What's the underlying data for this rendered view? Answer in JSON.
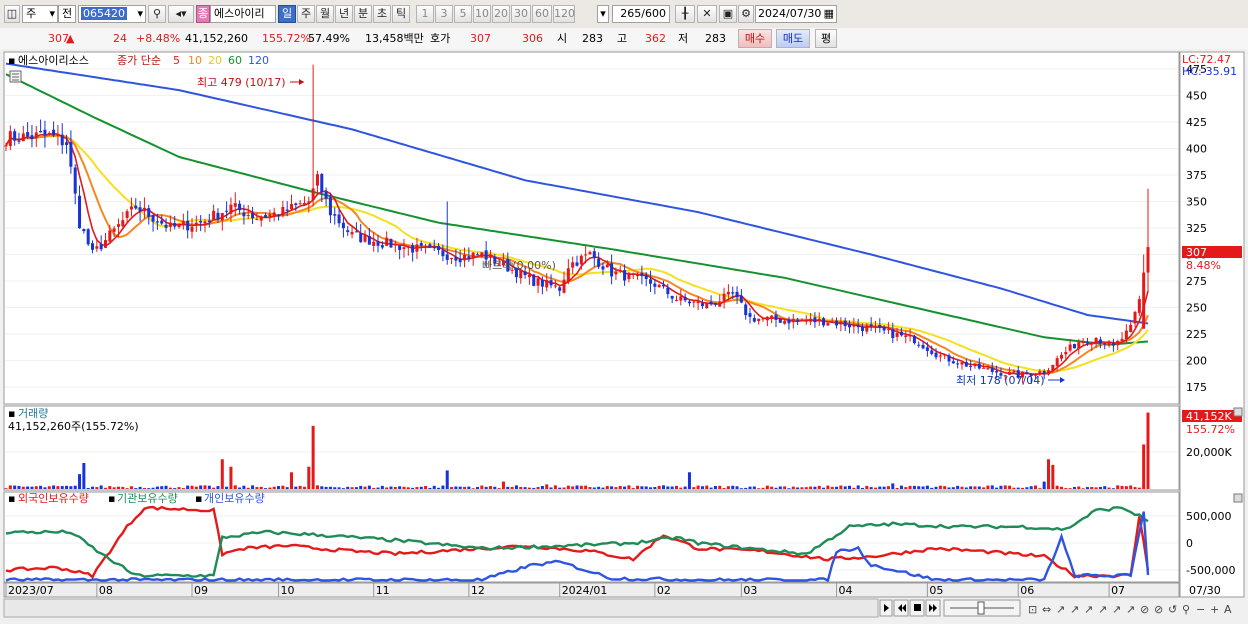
{
  "toolbar": {
    "period_type": "주",
    "prev_label": "전",
    "code": "065420",
    "name": "에스아이리",
    "name_badge": "종",
    "periods": [
      "일",
      "주",
      "월",
      "년",
      "분",
      "초",
      "틱"
    ],
    "active_period": "일",
    "intervals": [
      "1",
      "3",
      "5",
      "10",
      "20",
      "30",
      "60",
      "120"
    ],
    "count": "265",
    "count_total": "/600",
    "date": "2024/07/30"
  },
  "quote": {
    "price": "307",
    "change_arrow": "▲",
    "change": "24",
    "change_pct": "+8.48%",
    "volume": "41,152,260",
    "volume_pct": "155.72%",
    "turnover": "57.49%",
    "amount": "13,458백만",
    "bid_label": "호가",
    "bid1": "307",
    "bid2": "306",
    "open_label": "시",
    "open": "283",
    "high_label": "고",
    "high": "362",
    "low_label": "저",
    "low": "283",
    "buy_label": "매수",
    "sell_label": "매도",
    "avg_label": "평"
  },
  "colors": {
    "up": "#e41a1a",
    "down": "#1734d8",
    "ma5": "#e41a1a",
    "ma10": "#f5881f",
    "ma20": "#f4e01c",
    "ma60": "#15922e",
    "ma120": "#2f55e0",
    "foreign": "#e41a1a",
    "institution": "#1f8c58",
    "individual": "#2f55e0"
  },
  "chart_data": [
    {
      "type": "candlestick",
      "title": "에스아이리소스",
      "legend_prefix": "종가 단순",
      "ma_periods": [
        "5",
        "10",
        "20",
        "60",
        "120"
      ],
      "ylim": [
        160,
        490
      ],
      "y_ticks": [
        175,
        200,
        225,
        250,
        275,
        300,
        325,
        350,
        375,
        400,
        425,
        450,
        475
      ],
      "x_labels": [
        "2023/07",
        "08",
        "09",
        "10",
        "11",
        "12",
        "2024/01",
        "02",
        "03",
        "04",
        "05",
        "06",
        "07"
      ],
      "x_end_label": "07/30",
      "lc_label": "LC:72.47",
      "hc_label": "HC:-35.91",
      "last_price_label": "307",
      "last_pct_label": "8.48%",
      "annotations": {
        "high": "최고 479 (10/17)",
        "low": "최저 178 (07/04)",
        "mid": "빠르락(0.00%)"
      },
      "anchors": [
        [
          0,
          410
        ],
        [
          10,
          412
        ],
        [
          14,
          405
        ],
        [
          17,
          330
        ],
        [
          20,
          300
        ],
        [
          24,
          318
        ],
        [
          30,
          345
        ],
        [
          38,
          325
        ],
        [
          45,
          330
        ],
        [
          52,
          345
        ],
        [
          58,
          335
        ],
        [
          64,
          340
        ],
        [
          70,
          350
        ],
        [
          72,
          370
        ],
        [
          75,
          340
        ],
        [
          80,
          318
        ],
        [
          86,
          312
        ],
        [
          95,
          305
        ],
        [
          105,
          298
        ],
        [
          110,
          300
        ],
        [
          115,
          290
        ],
        [
          122,
          275
        ],
        [
          128,
          268
        ],
        [
          130,
          290
        ],
        [
          135,
          300
        ],
        [
          140,
          283
        ],
        [
          145,
          278
        ],
        [
          150,
          272
        ],
        [
          155,
          258
        ],
        [
          162,
          252
        ],
        [
          168,
          262
        ],
        [
          172,
          240
        ],
        [
          180,
          238
        ],
        [
          190,
          237
        ],
        [
          200,
          230
        ],
        [
          210,
          220
        ],
        [
          216,
          204
        ],
        [
          222,
          196
        ],
        [
          228,
          190
        ],
        [
          234,
          186
        ],
        [
          240,
          190
        ],
        [
          244,
          205
        ],
        [
          248,
          218
        ],
        [
          252,
          222
        ],
        [
          256,
          212
        ],
        [
          260,
          230
        ],
        [
          264,
          283
        ]
      ]
    },
    {
      "type": "bar",
      "title": "거래량",
      "readout": "41,152,260주(155.72%)",
      "value_tag": "41,152K",
      "pct_tag": "155.72%",
      "y_tick": "20,000K",
      "spikes": [
        [
          17,
          8000000
        ],
        [
          18,
          14000000
        ],
        [
          50,
          16000000
        ],
        [
          52,
          12000000
        ],
        [
          66,
          9000000
        ],
        [
          70,
          12000000
        ],
        [
          71,
          34000000
        ],
        [
          102,
          10000000
        ],
        [
          115,
          4000000
        ],
        [
          125,
          2500000
        ],
        [
          158,
          9000000
        ],
        [
          205,
          3000000
        ],
        [
          240,
          4000000
        ],
        [
          241,
          16000000
        ],
        [
          242,
          13000000
        ],
        [
          263,
          24000000
        ],
        [
          264,
          41152260
        ]
      ]
    },
    {
      "type": "line",
      "title_foreign": "외국인보유수량",
      "title_inst": "기관보유수량",
      "title_indiv": "개인보유수량",
      "y_ticks": [
        "500,000",
        "0",
        "-500,000"
      ],
      "ylim": [
        -700000,
        700000
      ],
      "series": [
        {
          "name": "외국인보유수량",
          "anchors": [
            [
              0,
              -500000
            ],
            [
              12,
              -450000
            ],
            [
              20,
              -600000
            ],
            [
              28,
              300000
            ],
            [
              32,
              650000
            ],
            [
              48,
              600000
            ],
            [
              50,
              -200000
            ],
            [
              55,
              -100000
            ],
            [
              65,
              -50000
            ],
            [
              72,
              -100000
            ],
            [
              80,
              -150000
            ],
            [
              90,
              -200000
            ],
            [
              100,
              -150000
            ],
            [
              120,
              -50000
            ],
            [
              135,
              -150000
            ],
            [
              145,
              -300000
            ],
            [
              152,
              150000
            ],
            [
              160,
              -100000
            ],
            [
              175,
              -150000
            ],
            [
              190,
              -300000
            ],
            [
              200,
              -250000
            ],
            [
              215,
              -100000
            ],
            [
              225,
              -150000
            ],
            [
              240,
              -250000
            ],
            [
              247,
              -600000
            ],
            [
              260,
              -600000
            ],
            [
              262,
              500000
            ],
            [
              264,
              -500000
            ]
          ]
        },
        {
          "name": "기관보유수량",
          "anchors": [
            [
              0,
              200000
            ],
            [
              15,
              200000
            ],
            [
              22,
              -200000
            ],
            [
              30,
              -600000
            ],
            [
              48,
              -600000
            ],
            [
              50,
              100000
            ],
            [
              60,
              200000
            ],
            [
              72,
              150000
            ],
            [
              90,
              50000
            ],
            [
              110,
              -100000
            ],
            [
              130,
              -50000
            ],
            [
              145,
              0
            ],
            [
              155,
              100000
            ],
            [
              160,
              0
            ],
            [
              172,
              -100000
            ],
            [
              185,
              -200000
            ],
            [
              195,
              300000
            ],
            [
              205,
              350000
            ],
            [
              220,
              300000
            ],
            [
              235,
              300000
            ],
            [
              245,
              250000
            ],
            [
              252,
              600000
            ],
            [
              258,
              650000
            ],
            [
              262,
              500000
            ],
            [
              264,
              400000
            ]
          ]
        },
        {
          "name": "개인보유수량",
          "anchors": [
            [
              0,
              -680000
            ],
            [
              110,
              -680000
            ],
            [
              122,
              -400000
            ],
            [
              128,
              -350000
            ],
            [
              140,
              -650000
            ],
            [
              160,
              -680000
            ],
            [
              190,
              -680000
            ],
            [
              192,
              -150000
            ],
            [
              197,
              -100000
            ],
            [
              200,
              -400000
            ],
            [
              215,
              -680000
            ],
            [
              240,
              -680000
            ],
            [
              244,
              100000
            ],
            [
              247,
              -600000
            ],
            [
              260,
              -600000
            ],
            [
              263,
              600000
            ],
            [
              264,
              -600000
            ]
          ]
        }
      ]
    }
  ]
}
